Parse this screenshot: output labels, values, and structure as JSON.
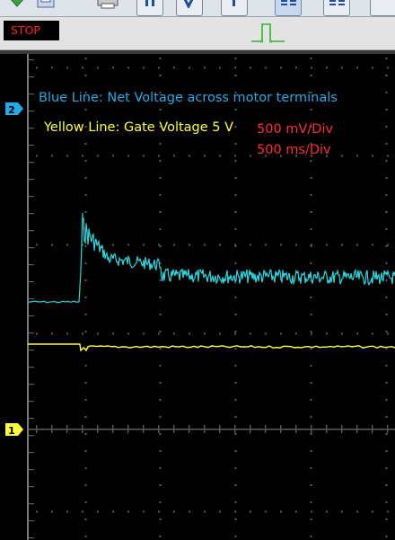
{
  "toolbar": {
    "buttons": [
      {
        "icon": "download-arrow-icon"
      },
      {
        "icon": "save-icon"
      },
      {
        "icon": "print-icon"
      },
      {
        "icon": "channel-select-icon"
      },
      {
        "icon": "channel-select-icon"
      },
      {
        "icon": "channel-select-icon"
      },
      {
        "icon": "grid-layout-icon"
      },
      {
        "icon": "grid-layout-icon"
      }
    ]
  },
  "status": {
    "run_state": "STOP",
    "trigger_icon": "pulse-trigger-icon"
  },
  "scope": {
    "channel_markers": [
      {
        "label": "2",
        "color": "#27a9e6"
      },
      {
        "label": "1",
        "color": "#ffff3c"
      }
    ],
    "annotations": {
      "blue_line": "Blue Line: Net Voltage across motor terminals",
      "yellow_line": "Yellow Line: Gate Voltage 5 V",
      "volts_per_div": "500 mV/Div",
      "time_per_div": "500 ms/Div"
    },
    "colors": {
      "channel_2": "#27d8e0",
      "channel_1": "#ffff3c",
      "grid": "#5a5a5a",
      "background": "#000000"
    }
  }
}
